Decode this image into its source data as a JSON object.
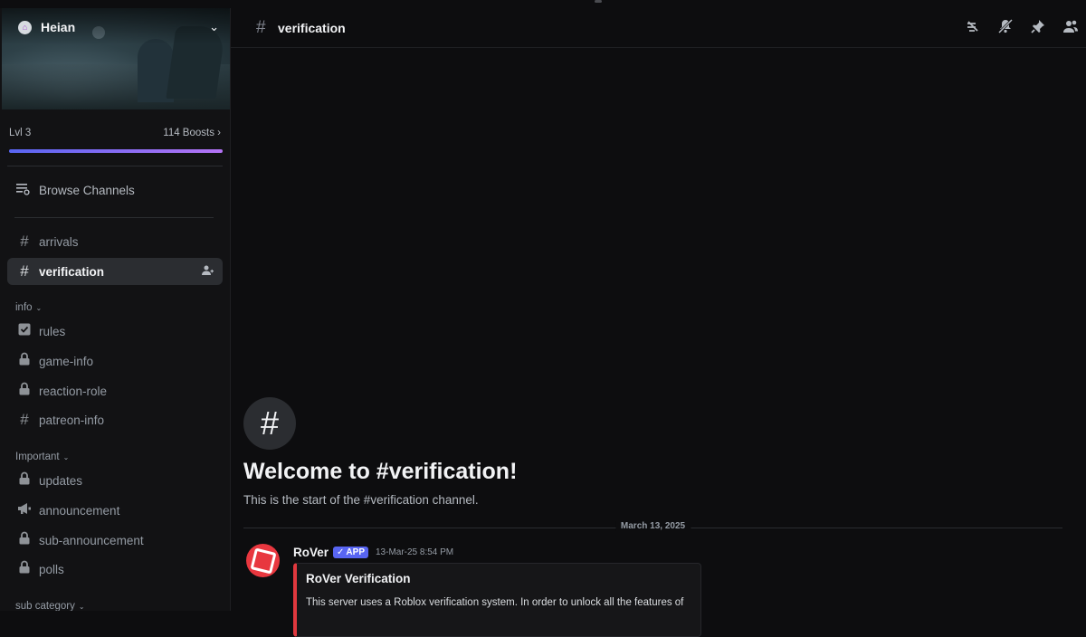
{
  "server": {
    "name": "Heian",
    "level": "Lvl 3",
    "boosts": "114 Boosts",
    "boost_progress": 1.0
  },
  "sidebar": {
    "browse_label": "Browse Channels",
    "channels_top": [
      {
        "label": "arrivals",
        "icon": "hash-icon"
      },
      {
        "label": "verification",
        "icon": "hash-icon",
        "active": true
      }
    ],
    "categories": [
      {
        "label": "info",
        "channels": [
          {
            "label": "rules",
            "icon": "rules-icon"
          },
          {
            "label": "game-info",
            "icon": "lock-icon"
          },
          {
            "label": "reaction-role",
            "icon": "lock-icon"
          },
          {
            "label": "patreon-info",
            "icon": "hash-icon"
          }
        ]
      },
      {
        "label": "Important",
        "channels": [
          {
            "label": "updates",
            "icon": "lock-icon"
          },
          {
            "label": "announcement",
            "icon": "megaphone-icon"
          },
          {
            "label": "sub-announcement",
            "icon": "lock-icon"
          },
          {
            "label": "polls",
            "icon": "lock-icon"
          }
        ]
      },
      {
        "label": "sub category",
        "channels": []
      }
    ]
  },
  "channel": {
    "name": "verification"
  },
  "welcome": {
    "title": "Welcome to #verification!",
    "subtitle": "This is the start of the #verification channel."
  },
  "date_separator": "March 13, 2025",
  "message": {
    "author": "RoVer",
    "badge": "APP",
    "timestamp": "13-Mar-25 8:54 PM",
    "embed_title": "RoVer Verification",
    "embed_description": "This server uses a Roblox verification system. In order to unlock all the features of"
  },
  "colors": {
    "accent": "#5865f2",
    "embed_border": "#e0383e",
    "avatar_bg": "#e8373f"
  }
}
